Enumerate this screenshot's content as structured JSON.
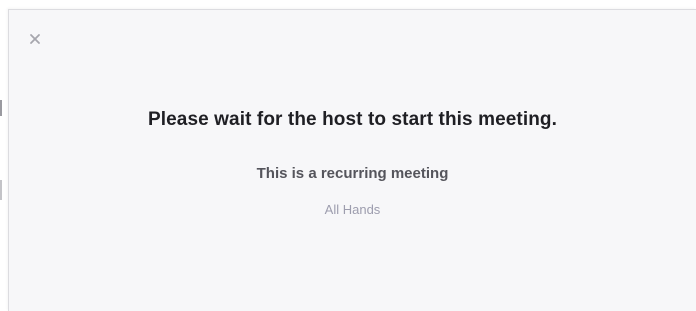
{
  "dialog": {
    "close_icon": "close-icon",
    "title": "Please wait for the host to start this meeting.",
    "subtitle": "This is a recurring meeting",
    "meeting_topic": "All Hands"
  },
  "colors": {
    "background": "#f7f7f9",
    "title": "#1f1f24",
    "subtitle": "#55555c",
    "topic": "#9d9dae",
    "close_icon": "#a6a6ad"
  }
}
